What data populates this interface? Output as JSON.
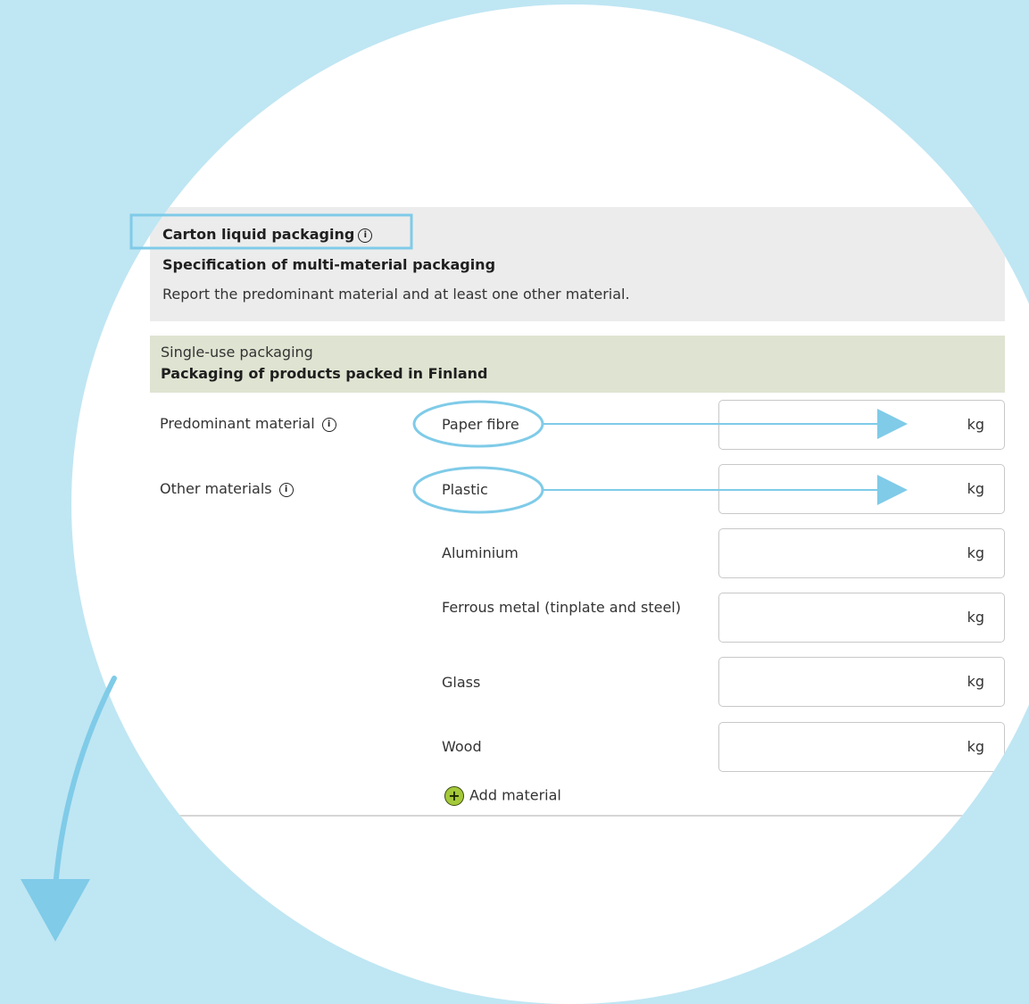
{
  "header": {
    "title": "Carton liquid packaging",
    "subtitle": "Specification of multi-material packaging",
    "description": "Report the predominant material and at least one other material."
  },
  "section": {
    "category": "Single-use packaging",
    "heading": "Packaging of products packed in Finland"
  },
  "rows": {
    "predominant_label": "Predominant material",
    "other_label": "Other materials"
  },
  "materials": [
    {
      "name": "Paper fibre",
      "value": "",
      "unit": "kg"
    },
    {
      "name": "Plastic",
      "value": "",
      "unit": "kg"
    },
    {
      "name": "Aluminium",
      "value": "",
      "unit": "kg"
    },
    {
      "name": "Ferrous metal (tinplate and steel)",
      "value": "",
      "unit": "kg"
    },
    {
      "name": "Glass",
      "value": "",
      "unit": "kg"
    },
    {
      "name": "Wood",
      "value": "",
      "unit": "kg"
    }
  ],
  "add_material_label": "Add material",
  "colors": {
    "background": "#bfe6f3",
    "annotation": "#7fcbe8",
    "header_panel": "#ececec",
    "section_panel": "#dfe4d2",
    "add_icon": "#a4c93a"
  }
}
